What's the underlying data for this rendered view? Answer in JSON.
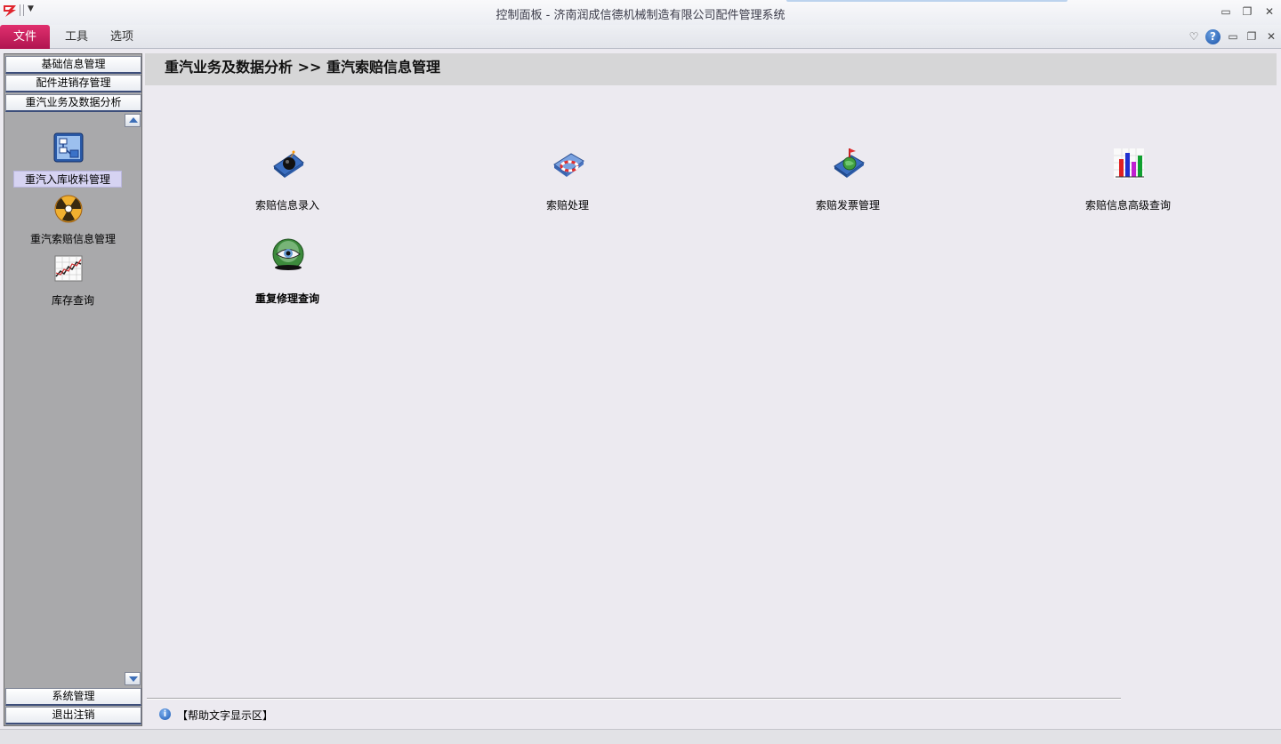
{
  "window": {
    "title": "控制面板 - 济南润成信德机械制造有限公司配件管理系统"
  },
  "ribbon": {
    "tabs": [
      {
        "label": "文件",
        "active": true
      },
      {
        "label": "工具"
      },
      {
        "label": "选项"
      }
    ]
  },
  "nav": {
    "groups_top": [
      {
        "label": "基础信息管理"
      },
      {
        "label": "配件进销存管理"
      },
      {
        "label": "重汽业务及数据分析"
      }
    ],
    "items": [
      {
        "label": "重汽入库收料管理",
        "icon": "flowchart-icon",
        "selected": true
      },
      {
        "label": "重汽索赔信息管理",
        "icon": "radiation-icon"
      },
      {
        "label": "库存查询",
        "icon": "line-chart-icon"
      }
    ],
    "groups_bottom": [
      {
        "label": "系统管理"
      },
      {
        "label": "退出注销"
      }
    ]
  },
  "main": {
    "breadcrumb": "重汽业务及数据分析 >> 重汽索赔信息管理",
    "tiles": [
      {
        "label": "索赔信息录入",
        "icon": "folder-bomb-icon"
      },
      {
        "label": "索赔处理",
        "icon": "folder-lifebuoy-icon"
      },
      {
        "label": "索赔发票管理",
        "icon": "folder-globe-icon"
      },
      {
        "label": "索赔信息高级查询",
        "icon": "bar-chart-icon"
      },
      {
        "label": "重复修理查询",
        "icon": "eye-icon"
      }
    ],
    "help_text": "【帮助文字显示区】"
  },
  "colors": {
    "file_tab": "#c41c5c",
    "nav_selected": "#d6d3f2",
    "breadcrumb_bg": "#d6d6d7"
  }
}
